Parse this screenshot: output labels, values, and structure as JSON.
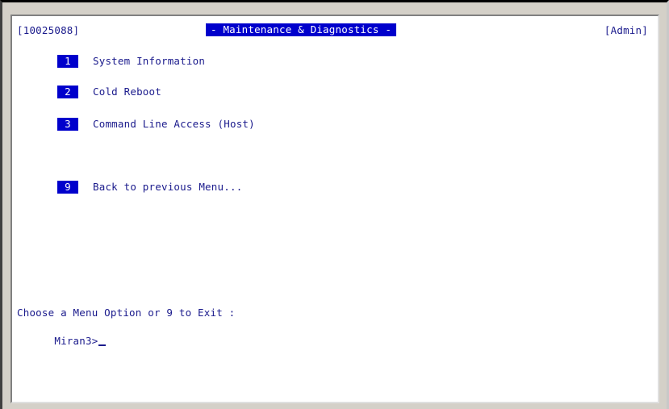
{
  "header": {
    "id_tag": "[10025088]",
    "title": "- Maintenance & Diagnostics -",
    "role": "[Admin]"
  },
  "menu": {
    "items": [
      {
        "key": "1",
        "label": "System Information"
      },
      {
        "key": "2",
        "label": "Cold Reboot"
      },
      {
        "key": "3",
        "label": "Command Line Access (Host)"
      },
      {
        "key": "9",
        "label": "Back to previous Menu..."
      }
    ]
  },
  "prompt": {
    "instruction": "Choose a Menu Option or 9 to Exit :",
    "input_prompt": "Miran3>"
  }
}
